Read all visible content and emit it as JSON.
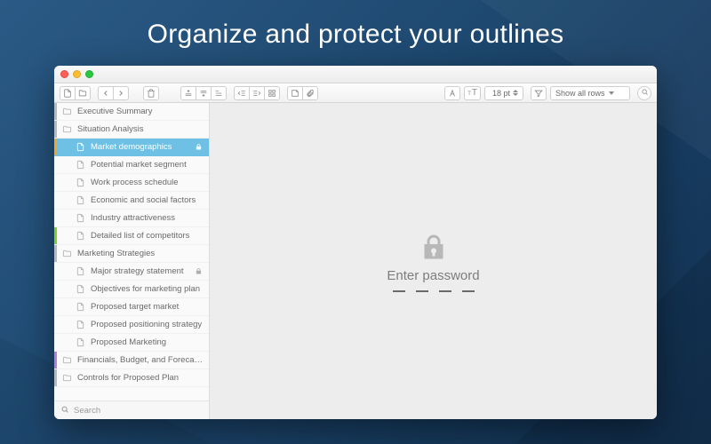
{
  "hero": {
    "headline": "Organize and protect your outlines"
  },
  "toolbar": {
    "font_size": "18 pt",
    "filter_label": "Show all rows"
  },
  "sidebar": {
    "search_placeholder": "Search",
    "items": [
      {
        "label": "Executive Summary",
        "type": "folder",
        "depth": 0,
        "stripe": "#b9b9b9",
        "selected": false,
        "locked": false
      },
      {
        "label": "Situation Analysis",
        "type": "folder",
        "depth": 0,
        "stripe": "#b9b9b9",
        "selected": false,
        "locked": false
      },
      {
        "label": "Market demographics",
        "type": "doc",
        "depth": 1,
        "stripe": "#f6a623",
        "selected": true,
        "locked": true
      },
      {
        "label": "Potential market segment",
        "type": "doc",
        "depth": 1,
        "stripe": "",
        "selected": false,
        "locked": false
      },
      {
        "label": "Work process schedule",
        "type": "doc",
        "depth": 1,
        "stripe": "",
        "selected": false,
        "locked": false
      },
      {
        "label": "Economic and social factors",
        "type": "doc",
        "depth": 1,
        "stripe": "",
        "selected": false,
        "locked": false
      },
      {
        "label": "Industry attractiveness",
        "type": "doc",
        "depth": 1,
        "stripe": "",
        "selected": false,
        "locked": false
      },
      {
        "label": "Detailed list of competitors",
        "type": "doc",
        "depth": 1,
        "stripe": "#7ed321",
        "selected": false,
        "locked": false
      },
      {
        "label": "Marketing Strategies",
        "type": "folder",
        "depth": 0,
        "stripe": "#b9b9b9",
        "selected": false,
        "locked": false
      },
      {
        "label": "Major strategy statement",
        "type": "doc",
        "depth": 1,
        "stripe": "",
        "selected": false,
        "locked": true
      },
      {
        "label": "Objectives for marketing plan",
        "type": "doc",
        "depth": 1,
        "stripe": "",
        "selected": false,
        "locked": false
      },
      {
        "label": "Proposed target market",
        "type": "doc",
        "depth": 1,
        "stripe": "",
        "selected": false,
        "locked": false
      },
      {
        "label": "Proposed positioning strategy",
        "type": "doc",
        "depth": 1,
        "stripe": "",
        "selected": false,
        "locked": false
      },
      {
        "label": "Proposed Marketing",
        "type": "doc",
        "depth": 1,
        "stripe": "",
        "selected": false,
        "locked": false
      },
      {
        "label": "Financials, Budget, and Forecasts",
        "type": "folder",
        "depth": 0,
        "stripe": "#b57edc",
        "selected": false,
        "locked": false
      },
      {
        "label": "Controls for Proposed Plan",
        "type": "folder",
        "depth": 0,
        "stripe": "#b9b9b9",
        "selected": false,
        "locked": false
      }
    ]
  },
  "content": {
    "prompt": "Enter password",
    "pin_length": 4
  }
}
